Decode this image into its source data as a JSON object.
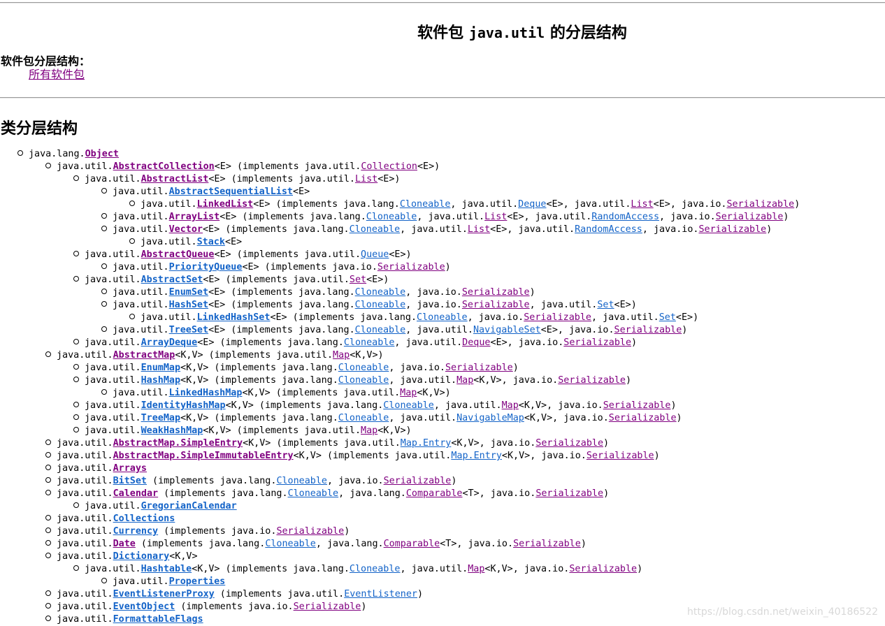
{
  "header": {
    "title_prefix": "软件包",
    "title_package": "java.util",
    "title_suffix": "的分层结构",
    "package_hierarchies_label": "软件包分层结构：",
    "all_packages_link": "所有软件包"
  },
  "section": {
    "class_hierarchy_heading": "类分层结构"
  },
  "colors": {
    "visited_link": "#800080",
    "link": "#1363c8"
  },
  "tree": [
    {
      "level": 0,
      "parts": [
        [
          "t",
          "java.lang."
        ],
        [
          "c",
          "Object",
          "purple"
        ]
      ]
    },
    {
      "level": 1,
      "parts": [
        [
          "t",
          "java.util."
        ],
        [
          "c",
          "AbstractCollection",
          "purple"
        ],
        [
          "t",
          "<E> (implements java.util."
        ],
        [
          "l",
          "Collection",
          "purple"
        ],
        [
          "t",
          "<E>)"
        ]
      ]
    },
    {
      "level": 2,
      "parts": [
        [
          "t",
          "java.util."
        ],
        [
          "c",
          "AbstractList",
          "purple"
        ],
        [
          "t",
          "<E> (implements java.util."
        ],
        [
          "l",
          "List",
          "purple"
        ],
        [
          "t",
          "<E>)"
        ]
      ]
    },
    {
      "level": 3,
      "parts": [
        [
          "t",
          "java.util."
        ],
        [
          "c",
          "AbstractSequentialList",
          "blue"
        ],
        [
          "t",
          "<E>"
        ]
      ]
    },
    {
      "level": 4,
      "parts": [
        [
          "t",
          "java.util."
        ],
        [
          "c",
          "LinkedList",
          "purple"
        ],
        [
          "t",
          "<E> (implements java.lang."
        ],
        [
          "l",
          "Cloneable",
          "blue"
        ],
        [
          "t",
          ", java.util."
        ],
        [
          "l",
          "Deque",
          "blue"
        ],
        [
          "t",
          "<E>, java.util."
        ],
        [
          "l",
          "List",
          "purple"
        ],
        [
          "t",
          "<E>, java.io."
        ],
        [
          "l",
          "Serializable",
          "purple"
        ],
        [
          "t",
          ")"
        ]
      ]
    },
    {
      "level": 3,
      "parts": [
        [
          "t",
          "java.util."
        ],
        [
          "c",
          "ArrayList",
          "purple"
        ],
        [
          "t",
          "<E> (implements java.lang."
        ],
        [
          "l",
          "Cloneable",
          "blue"
        ],
        [
          "t",
          ", java.util."
        ],
        [
          "l",
          "List",
          "purple"
        ],
        [
          "t",
          "<E>, java.util."
        ],
        [
          "l",
          "RandomAccess",
          "blue"
        ],
        [
          "t",
          ", java.io."
        ],
        [
          "l",
          "Serializable",
          "purple"
        ],
        [
          "t",
          ")"
        ]
      ]
    },
    {
      "level": 3,
      "parts": [
        [
          "t",
          "java.util."
        ],
        [
          "c",
          "Vector",
          "purple"
        ],
        [
          "t",
          "<E> (implements java.lang."
        ],
        [
          "l",
          "Cloneable",
          "blue"
        ],
        [
          "t",
          ", java.util."
        ],
        [
          "l",
          "List",
          "purple"
        ],
        [
          "t",
          "<E>, java.util."
        ],
        [
          "l",
          "RandomAccess",
          "blue"
        ],
        [
          "t",
          ", java.io."
        ],
        [
          "l",
          "Serializable",
          "purple"
        ],
        [
          "t",
          ")"
        ]
      ]
    },
    {
      "level": 4,
      "parts": [
        [
          "t",
          "java.util."
        ],
        [
          "c",
          "Stack",
          "blue"
        ],
        [
          "t",
          "<E>"
        ]
      ]
    },
    {
      "level": 2,
      "parts": [
        [
          "t",
          "java.util."
        ],
        [
          "c",
          "AbstractQueue",
          "purple"
        ],
        [
          "t",
          "<E> (implements java.util."
        ],
        [
          "l",
          "Queue",
          "blue"
        ],
        [
          "t",
          "<E>)"
        ]
      ]
    },
    {
      "level": 3,
      "parts": [
        [
          "t",
          "java.util."
        ],
        [
          "c",
          "PriorityQueue",
          "blue"
        ],
        [
          "t",
          "<E> (implements java.io."
        ],
        [
          "l",
          "Serializable",
          "purple"
        ],
        [
          "t",
          ")"
        ]
      ]
    },
    {
      "level": 2,
      "parts": [
        [
          "t",
          "java.util."
        ],
        [
          "c",
          "AbstractSet",
          "blue"
        ],
        [
          "t",
          "<E> (implements java.util."
        ],
        [
          "l",
          "Set",
          "purple"
        ],
        [
          "t",
          "<E>)"
        ]
      ]
    },
    {
      "level": 3,
      "parts": [
        [
          "t",
          "java.util."
        ],
        [
          "c",
          "EnumSet",
          "blue"
        ],
        [
          "t",
          "<E> (implements java.lang."
        ],
        [
          "l",
          "Cloneable",
          "blue"
        ],
        [
          "t",
          ", java.io."
        ],
        [
          "l",
          "Serializable",
          "purple"
        ],
        [
          "t",
          ")"
        ]
      ]
    },
    {
      "level": 3,
      "parts": [
        [
          "t",
          "java.util."
        ],
        [
          "c",
          "HashSet",
          "blue"
        ],
        [
          "t",
          "<E> (implements java.lang."
        ],
        [
          "l",
          "Cloneable",
          "blue"
        ],
        [
          "t",
          ", java.io."
        ],
        [
          "l",
          "Serializable",
          "purple"
        ],
        [
          "t",
          ", java.util."
        ],
        [
          "l",
          "Set",
          "blue"
        ],
        [
          "t",
          "<E>)"
        ]
      ]
    },
    {
      "level": 4,
      "parts": [
        [
          "t",
          "java.util."
        ],
        [
          "c",
          "LinkedHashSet",
          "blue"
        ],
        [
          "t",
          "<E> (implements java.lang."
        ],
        [
          "l",
          "Cloneable",
          "blue"
        ],
        [
          "t",
          ", java.io."
        ],
        [
          "l",
          "Serializable",
          "purple"
        ],
        [
          "t",
          ", java.util."
        ],
        [
          "l",
          "Set",
          "blue"
        ],
        [
          "t",
          "<E>)"
        ]
      ]
    },
    {
      "level": 3,
      "parts": [
        [
          "t",
          "java.util."
        ],
        [
          "c",
          "TreeSet",
          "blue"
        ],
        [
          "t",
          "<E> (implements java.lang."
        ],
        [
          "l",
          "Cloneable",
          "blue"
        ],
        [
          "t",
          ", java.util."
        ],
        [
          "l",
          "NavigableSet",
          "blue"
        ],
        [
          "t",
          "<E>, java.io."
        ],
        [
          "l",
          "Serializable",
          "purple"
        ],
        [
          "t",
          ")"
        ]
      ]
    },
    {
      "level": 2,
      "parts": [
        [
          "t",
          "java.util."
        ],
        [
          "c",
          "ArrayDeque",
          "blue"
        ],
        [
          "t",
          "<E> (implements java.lang."
        ],
        [
          "l",
          "Cloneable",
          "blue"
        ],
        [
          "t",
          ", java.util."
        ],
        [
          "l",
          "Deque",
          "purple"
        ],
        [
          "t",
          "<E>, java.io."
        ],
        [
          "l",
          "Serializable",
          "purple"
        ],
        [
          "t",
          ")"
        ]
      ]
    },
    {
      "level": 1,
      "parts": [
        [
          "t",
          "java.util."
        ],
        [
          "c",
          "AbstractMap",
          "purple"
        ],
        [
          "t",
          "<K,V> (implements java.util."
        ],
        [
          "l",
          "Map",
          "purple"
        ],
        [
          "t",
          "<K,V>)"
        ]
      ]
    },
    {
      "level": 2,
      "parts": [
        [
          "t",
          "java.util."
        ],
        [
          "c",
          "EnumMap",
          "blue"
        ],
        [
          "t",
          "<K,V> (implements java.lang."
        ],
        [
          "l",
          "Cloneable",
          "blue"
        ],
        [
          "t",
          ", java.io."
        ],
        [
          "l",
          "Serializable",
          "purple"
        ],
        [
          "t",
          ")"
        ]
      ]
    },
    {
      "level": 2,
      "parts": [
        [
          "t",
          "java.util."
        ],
        [
          "c",
          "HashMap",
          "blue"
        ],
        [
          "t",
          "<K,V> (implements java.lang."
        ],
        [
          "l",
          "Cloneable",
          "blue"
        ],
        [
          "t",
          ", java.util."
        ],
        [
          "l",
          "Map",
          "purple"
        ],
        [
          "t",
          "<K,V>, java.io."
        ],
        [
          "l",
          "Serializable",
          "purple"
        ],
        [
          "t",
          ")"
        ]
      ]
    },
    {
      "level": 3,
      "parts": [
        [
          "t",
          "java.util."
        ],
        [
          "c",
          "LinkedHashMap",
          "blue"
        ],
        [
          "t",
          "<K,V> (implements java.util."
        ],
        [
          "l",
          "Map",
          "purple"
        ],
        [
          "t",
          "<K,V>)"
        ]
      ]
    },
    {
      "level": 2,
      "parts": [
        [
          "t",
          "java.util."
        ],
        [
          "c",
          "IdentityHashMap",
          "blue"
        ],
        [
          "t",
          "<K,V> (implements java.lang."
        ],
        [
          "l",
          "Cloneable",
          "blue"
        ],
        [
          "t",
          ", java.util."
        ],
        [
          "l",
          "Map",
          "purple"
        ],
        [
          "t",
          "<K,V>, java.io."
        ],
        [
          "l",
          "Serializable",
          "purple"
        ],
        [
          "t",
          ")"
        ]
      ]
    },
    {
      "level": 2,
      "parts": [
        [
          "t",
          "java.util."
        ],
        [
          "c",
          "TreeMap",
          "blue"
        ],
        [
          "t",
          "<K,V> (implements java.lang."
        ],
        [
          "l",
          "Cloneable",
          "blue"
        ],
        [
          "t",
          ", java.util."
        ],
        [
          "l",
          "NavigableMap",
          "blue"
        ],
        [
          "t",
          "<K,V>, java.io."
        ],
        [
          "l",
          "Serializable",
          "purple"
        ],
        [
          "t",
          ")"
        ]
      ]
    },
    {
      "level": 2,
      "parts": [
        [
          "t",
          "java.util."
        ],
        [
          "c",
          "WeakHashMap",
          "blue"
        ],
        [
          "t",
          "<K,V> (implements java.util."
        ],
        [
          "l",
          "Map",
          "purple"
        ],
        [
          "t",
          "<K,V>)"
        ]
      ]
    },
    {
      "level": 1,
      "parts": [
        [
          "t",
          "java.util."
        ],
        [
          "c",
          "AbstractMap.SimpleEntry",
          "purple"
        ],
        [
          "t",
          "<K,V> (implements java.util."
        ],
        [
          "l",
          "Map.Entry",
          "blue"
        ],
        [
          "t",
          "<K,V>, java.io."
        ],
        [
          "l",
          "Serializable",
          "purple"
        ],
        [
          "t",
          ")"
        ]
      ]
    },
    {
      "level": 1,
      "parts": [
        [
          "t",
          "java.util."
        ],
        [
          "c",
          "AbstractMap.SimpleImmutableEntry",
          "purple"
        ],
        [
          "t",
          "<K,V> (implements java.util."
        ],
        [
          "l",
          "Map.Entry",
          "blue"
        ],
        [
          "t",
          "<K,V>, java.io."
        ],
        [
          "l",
          "Serializable",
          "purple"
        ],
        [
          "t",
          ")"
        ]
      ]
    },
    {
      "level": 1,
      "parts": [
        [
          "t",
          "java.util."
        ],
        [
          "c",
          "Arrays",
          "purple"
        ]
      ]
    },
    {
      "level": 1,
      "parts": [
        [
          "t",
          "java.util."
        ],
        [
          "c",
          "BitSet",
          "blue"
        ],
        [
          "t",
          " (implements java.lang."
        ],
        [
          "l",
          "Cloneable",
          "blue"
        ],
        [
          "t",
          ", java.io."
        ],
        [
          "l",
          "Serializable",
          "purple"
        ],
        [
          "t",
          ")"
        ]
      ]
    },
    {
      "level": 1,
      "parts": [
        [
          "t",
          "java.util."
        ],
        [
          "c",
          "Calendar",
          "purple"
        ],
        [
          "t",
          " (implements java.lang."
        ],
        [
          "l",
          "Cloneable",
          "blue"
        ],
        [
          "t",
          ", java.lang."
        ],
        [
          "l",
          "Comparable",
          "purple"
        ],
        [
          "t",
          "<T>, java.io."
        ],
        [
          "l",
          "Serializable",
          "purple"
        ],
        [
          "t",
          ")"
        ]
      ]
    },
    {
      "level": 2,
      "parts": [
        [
          "t",
          "java.util."
        ],
        [
          "c",
          "GregorianCalendar",
          "blue"
        ]
      ]
    },
    {
      "level": 1,
      "parts": [
        [
          "t",
          "java.util."
        ],
        [
          "c",
          "Collections",
          "blue"
        ]
      ]
    },
    {
      "level": 1,
      "parts": [
        [
          "t",
          "java.util."
        ],
        [
          "c",
          "Currency",
          "blue"
        ],
        [
          "t",
          " (implements java.io."
        ],
        [
          "l",
          "Serializable",
          "purple"
        ],
        [
          "t",
          ")"
        ]
      ]
    },
    {
      "level": 1,
      "parts": [
        [
          "t",
          "java.util."
        ],
        [
          "c",
          "Date",
          "purple"
        ],
        [
          "t",
          " (implements java.lang."
        ],
        [
          "l",
          "Cloneable",
          "blue"
        ],
        [
          "t",
          ", java.lang."
        ],
        [
          "l",
          "Comparable",
          "purple"
        ],
        [
          "t",
          "<T>, java.io."
        ],
        [
          "l",
          "Serializable",
          "purple"
        ],
        [
          "t",
          ")"
        ]
      ]
    },
    {
      "level": 1,
      "parts": [
        [
          "t",
          "java.util."
        ],
        [
          "c",
          "Dictionary",
          "blue"
        ],
        [
          "t",
          "<K,V>"
        ]
      ]
    },
    {
      "level": 2,
      "parts": [
        [
          "t",
          "java.util."
        ],
        [
          "c",
          "Hashtable",
          "blue"
        ],
        [
          "t",
          "<K,V> (implements java.lang."
        ],
        [
          "l",
          "Cloneable",
          "blue"
        ],
        [
          "t",
          ", java.util."
        ],
        [
          "l",
          "Map",
          "purple"
        ],
        [
          "t",
          "<K,V>, java.io."
        ],
        [
          "l",
          "Serializable",
          "purple"
        ],
        [
          "t",
          ")"
        ]
      ]
    },
    {
      "level": 3,
      "parts": [
        [
          "t",
          "java.util."
        ],
        [
          "c",
          "Properties",
          "blue"
        ]
      ]
    },
    {
      "level": 1,
      "parts": [
        [
          "t",
          "java.util."
        ],
        [
          "c",
          "EventListenerProxy",
          "blue"
        ],
        [
          "t",
          " (implements java.util."
        ],
        [
          "l",
          "EventListener",
          "blue"
        ],
        [
          "t",
          ")"
        ]
      ]
    },
    {
      "level": 1,
      "parts": [
        [
          "t",
          "java.util."
        ],
        [
          "c",
          "EventObject",
          "blue"
        ],
        [
          "t",
          " (implements java.io."
        ],
        [
          "l",
          "Serializable",
          "purple"
        ],
        [
          "t",
          ")"
        ]
      ]
    },
    {
      "level": 1,
      "parts": [
        [
          "t",
          "java.util."
        ],
        [
          "c",
          "FormattableFlags",
          "blue"
        ]
      ]
    }
  ],
  "watermark": "https://blog.csdn.net/weixin_40186522"
}
